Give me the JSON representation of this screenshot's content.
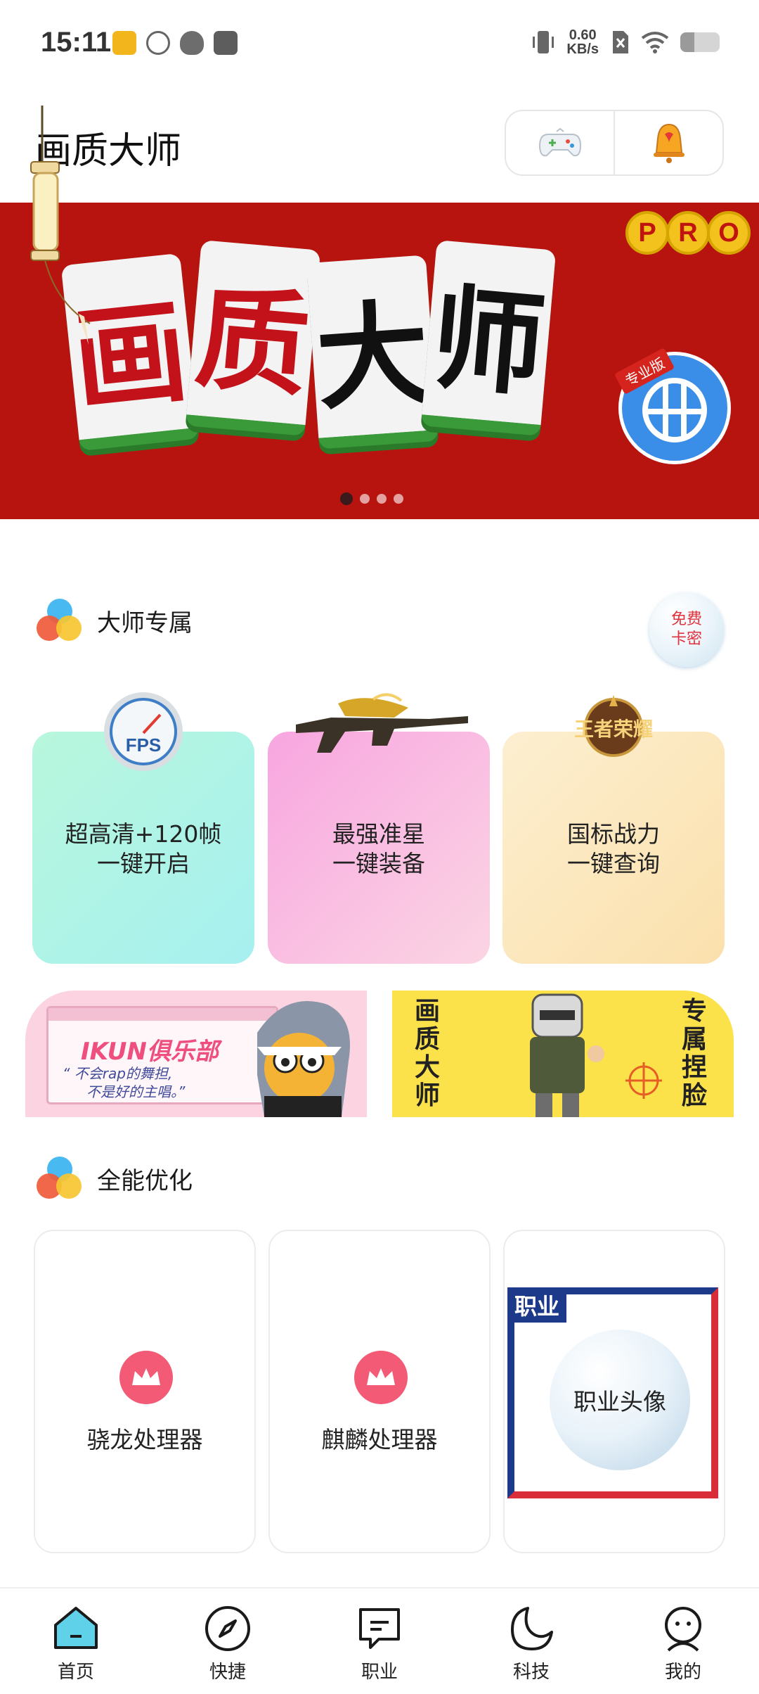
{
  "status_bar": {
    "time": "15:11",
    "net_speed_value": "0.60",
    "net_speed_unit": "KB/s",
    "battery_level": 0.35,
    "icons": [
      "news-app-icon",
      "leaf-app-icon",
      "cat-app-icon",
      "inbox-app-icon",
      "vibrate-icon",
      "no-sim-icon",
      "wifi-icon",
      "battery-icon"
    ]
  },
  "header": {
    "title": "画质大师",
    "actions": [
      "gamepad-icon",
      "bell-icon"
    ]
  },
  "banner": {
    "tiles": [
      "画",
      "质",
      "大",
      "师"
    ],
    "pro_letters": [
      "P",
      "R",
      "O"
    ],
    "seal_tag": "专业版",
    "slide_count": 4,
    "active_slide": 1,
    "colors": {
      "background": "#b8140f",
      "tile_base": "#3a9a3a",
      "seal": "#3a8ee8"
    }
  },
  "section_exclusive": {
    "title": "大师专属",
    "free_card_line1": "免费",
    "free_card_line2": "卡密",
    "cards": [
      {
        "line1": "超高清+120帧",
        "line2": "一键开启",
        "icon": "fps-gauge-icon",
        "icon_text": "FPS"
      },
      {
        "line1": "最强准星",
        "line2": "一键装备",
        "icon": "rifle-icon"
      },
      {
        "line1": "国标战力",
        "line2": "一键查询",
        "icon": "honor-of-kings-logo",
        "icon_text": "王者荣耀"
      }
    ]
  },
  "promos": {
    "left": {
      "title": "IKUN俱乐部",
      "quote_line1": "“ 不会rap的舞担,",
      "quote_line2": "不是好的主唱。”"
    },
    "right": {
      "left_text": "画质大师",
      "right_text": "专属捏脸"
    }
  },
  "section_optimize": {
    "title": "全能优化",
    "cards": [
      {
        "label": "骁龙处理器",
        "icon": "crown-icon"
      },
      {
        "label": "麒麟处理器",
        "icon": "crown-icon"
      },
      {
        "label": "职业头像",
        "tag": "职业"
      }
    ]
  },
  "bottom_nav": {
    "items": [
      {
        "label": "首页",
        "icon": "home-icon",
        "active": true
      },
      {
        "label": "快捷",
        "icon": "compass-icon",
        "active": false
      },
      {
        "label": "职业",
        "icon": "message-icon",
        "active": false
      },
      {
        "label": "科技",
        "icon": "moon-icon",
        "active": false
      },
      {
        "label": "我的",
        "icon": "profile-icon",
        "active": false
      }
    ]
  }
}
